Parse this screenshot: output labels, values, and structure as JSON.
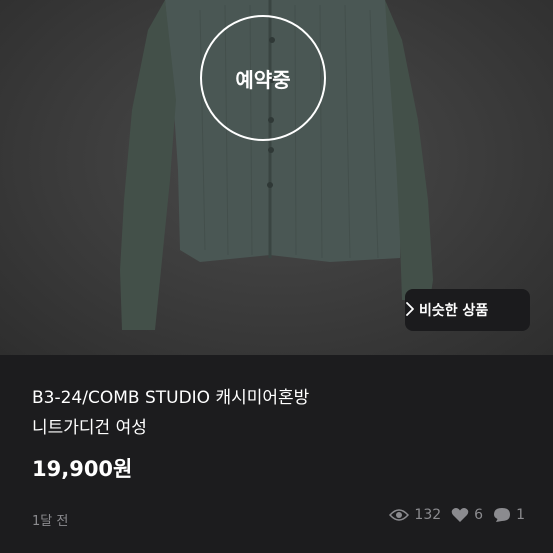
{
  "photo": {
    "reserved_label": "예약중",
    "similar_button_label": "비슷한 상품"
  },
  "product": {
    "title_line1": "B3-24/COMB STUDIO 캐시미어혼방",
    "title_line2": "니트가디건 여성",
    "price": "19,900원",
    "time_ago": "1달 전"
  },
  "stats": {
    "views": "132",
    "likes": "6",
    "chats": "1"
  },
  "icons": {
    "similar_chevron": "chevron-right-icon",
    "views": "eye-icon",
    "likes": "heart-icon",
    "chats": "chat-bubble-icon"
  }
}
